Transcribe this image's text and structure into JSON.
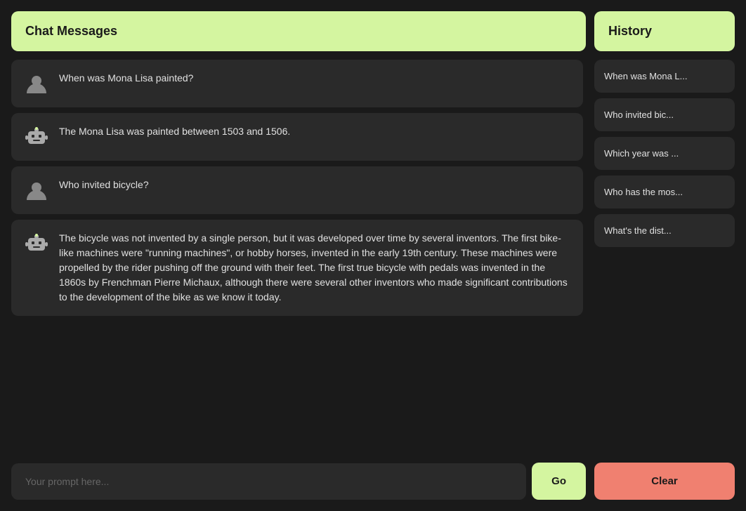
{
  "main_panel": {
    "header": {
      "title": "Chat Messages"
    },
    "messages": [
      {
        "id": "msg1",
        "type": "user",
        "text": "When was Mona Lisa painted?"
      },
      {
        "id": "msg2",
        "type": "bot",
        "text": "The Mona Lisa was painted between 1503 and 1506."
      },
      {
        "id": "msg3",
        "type": "user",
        "text": "Who invited bicycle?"
      },
      {
        "id": "msg4",
        "type": "bot",
        "text": "The bicycle was not invented by a single person, but it was developed over time by several inventors. The first bike-like machines were \"running machines\", or hobby horses, invented in the early 19th century. These machines were propelled by the rider pushing off the ground with their feet. The first true bicycle with pedals was invented in the 1860s by Frenchman Pierre Michaux, although there were several other inventors who made significant contributions to the development of the bike as we know it today."
      }
    ],
    "input": {
      "placeholder": "Your prompt here...",
      "value": ""
    },
    "go_button_label": "Go"
  },
  "sidebar": {
    "header": {
      "title": "History"
    },
    "items": [
      {
        "label": "When was Mona L..."
      },
      {
        "label": "Who invited bic..."
      },
      {
        "label": "Which year was ..."
      },
      {
        "label": "Who has the mos..."
      },
      {
        "label": "What's the dist..."
      }
    ],
    "clear_button_label": "Clear"
  }
}
